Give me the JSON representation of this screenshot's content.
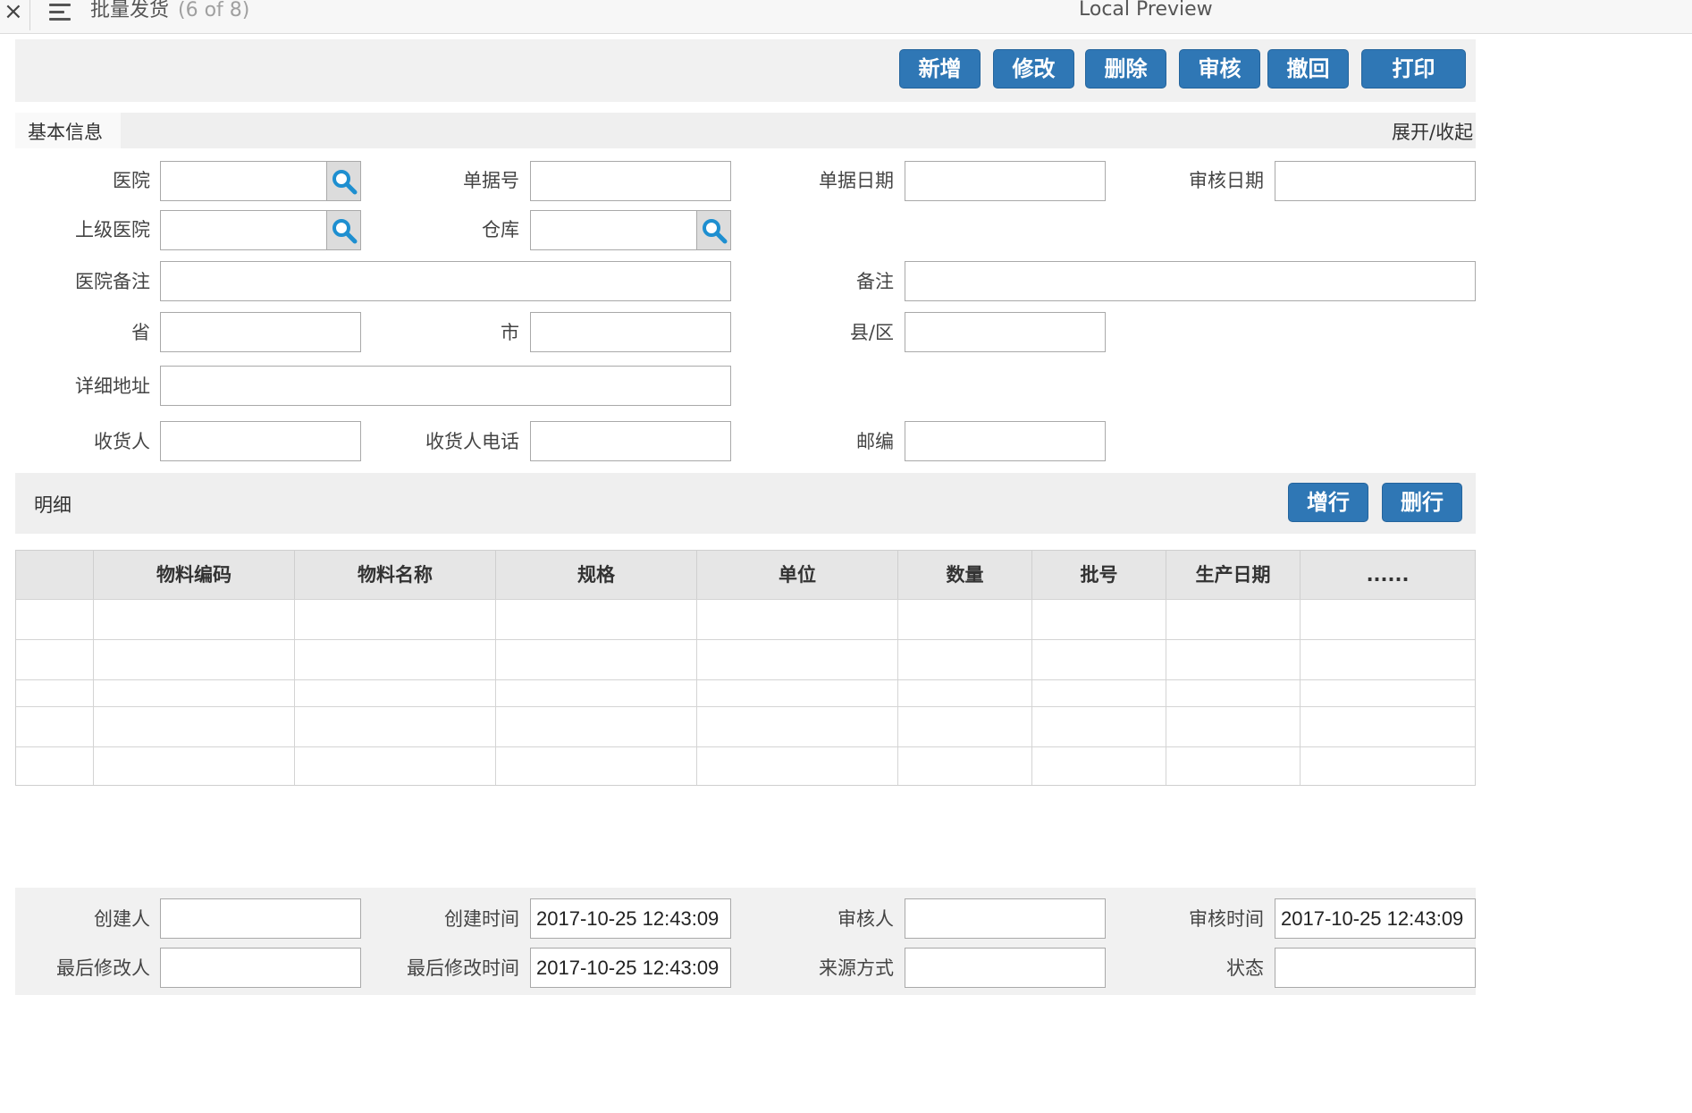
{
  "titlebar": {
    "close": "×",
    "title": "批量发货",
    "count": "(6 of 8)",
    "preview": "Local Preview"
  },
  "toolbar": {
    "add": "新增",
    "edit": "修改",
    "delete": "删除",
    "audit": "审核",
    "revoke": "撤回",
    "print": "打印"
  },
  "basic": {
    "tab": "基本信息",
    "toggle": "展开/收起",
    "fields": {
      "hospital": {
        "label": "医院",
        "value": ""
      },
      "doc_no": {
        "label": "单据号",
        "value": ""
      },
      "doc_date": {
        "label": "单据日期",
        "value": ""
      },
      "audit_date": {
        "label": "审核日期",
        "value": ""
      },
      "parent_hospital": {
        "label": "上级医院",
        "value": ""
      },
      "warehouse": {
        "label": "仓库",
        "value": ""
      },
      "hospital_note": {
        "label": "医院备注",
        "value": ""
      },
      "note": {
        "label": "备注",
        "value": ""
      },
      "province": {
        "label": "省",
        "value": ""
      },
      "city": {
        "label": "市",
        "value": ""
      },
      "district": {
        "label": "县/区",
        "value": ""
      },
      "address": {
        "label": "详细地址",
        "value": ""
      },
      "receiver": {
        "label": "收货人",
        "value": ""
      },
      "receiver_phone": {
        "label": "收货人电话",
        "value": ""
      },
      "postcode": {
        "label": "邮编",
        "value": ""
      }
    }
  },
  "detail": {
    "title": "明细",
    "add_row": "增行",
    "delete_row": "删行",
    "columns": [
      "",
      "物料编码",
      "物料名称",
      "规格",
      "单位",
      "数量",
      "批号",
      "生产日期",
      "......"
    ],
    "rows": [
      [
        "",
        "",
        "",
        "",
        "",
        "",
        "",
        "",
        ""
      ],
      [
        "",
        "",
        "",
        "",
        "",
        "",
        "",
        "",
        ""
      ],
      [
        "",
        "",
        "",
        "",
        "",
        "",
        "",
        "",
        ""
      ],
      [
        "",
        "",
        "",
        "",
        "",
        "",
        "",
        "",
        ""
      ],
      [
        "",
        "",
        "",
        "",
        "",
        "",
        "",
        "",
        ""
      ]
    ]
  },
  "footer": {
    "creator": {
      "label": "创建人",
      "value": ""
    },
    "created_at": {
      "label": "创建时间",
      "value": "2017-10-25 12:43:09"
    },
    "auditor": {
      "label": "审核人",
      "value": ""
    },
    "audited_at": {
      "label": "审核时间",
      "value": "2017-10-25 12:43:09"
    },
    "last_modifier": {
      "label": "最后修改人",
      "value": ""
    },
    "last_modified_at": {
      "label": "最后修改时间",
      "value": "2017-10-25 12:43:09"
    },
    "source": {
      "label": "来源方式",
      "value": ""
    },
    "status": {
      "label": "状态",
      "value": ""
    }
  },
  "colors": {
    "button": "#2f77b5",
    "panel": "#f1f1f1",
    "search_icon": "#1e8fd0"
  }
}
